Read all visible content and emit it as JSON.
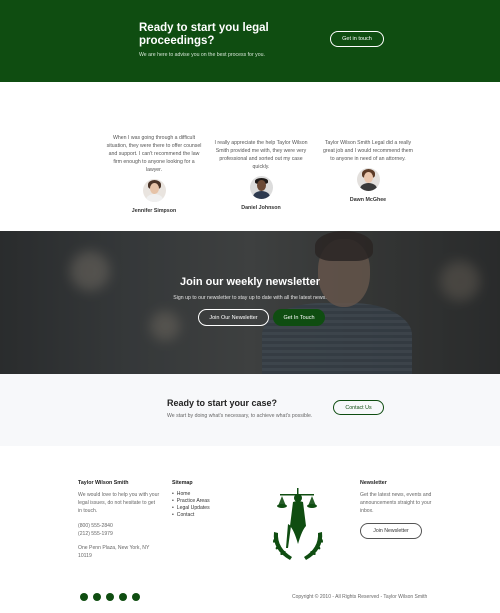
{
  "cta_top": {
    "title": "Ready to start you legal proceedings?",
    "subtitle": "We are here to advise you on the best process for you.",
    "button": "Get in touch"
  },
  "testimonials": [
    {
      "quote": "When I was going through a difficult situation, they were there to offer counsel and support. I can't recommend the law firm enough to anyone looking for a lawyer.",
      "name": "Jennifer Simpson"
    },
    {
      "quote": "I really appreciate the help Taylor Wilson Smith provided me with, they were very professional and sorted out my case quickly.",
      "name": "Daniel Johnson"
    },
    {
      "quote": "Taylor Wilson Smith Legal did a really great job and I would recommend them to anyone in need of an attorney.",
      "name": "Dawn McGhee"
    }
  ],
  "newsletter": {
    "title": "Join our weekly newsletter",
    "subtitle": "Sign up to our newsletter to stay up to date with all the latest news.",
    "join_button": "Join Our Newsletter",
    "contact_button": "Get In Touch"
  },
  "case_cta": {
    "title": "Ready to start your case?",
    "subtitle": "We start by doing what's necessary, to achieve what's possible.",
    "button": "Contact Us"
  },
  "footer": {
    "about": {
      "title": "Taylor Wilson Smith",
      "text": "We would love to help you with your legal issues, do not hesitate to get in touch.",
      "phone1": "(800) 555-2840",
      "phone2": "(212) 555-1979",
      "address": "One Penn Plaza, New York, NY 10119"
    },
    "sitemap": {
      "title": "Sitemap",
      "items": [
        "Home",
        "Practice Areas",
        "Legal Updates",
        "Contact"
      ]
    },
    "newsletter": {
      "title": "Newsletter",
      "text": "Get the latest news, events and announcements straight to your inbox.",
      "button": "Join Newsletter"
    },
    "social_icons": [
      "facebook-icon",
      "twitter-icon",
      "pinterest-icon",
      "linkedin-icon",
      "youtube-icon"
    ],
    "copyright": "Copyright © 2010 - All Rights Reserved - Taylor Wilson Smith"
  },
  "colors": {
    "brand_green": "#0f4d11",
    "background": "#f7f8fa"
  }
}
